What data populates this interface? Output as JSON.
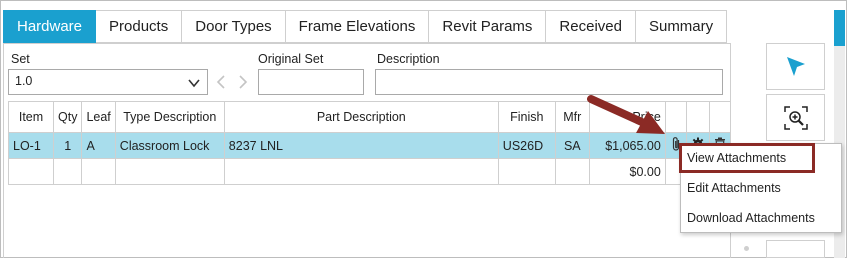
{
  "tabs": [
    {
      "label": "Hardware",
      "active": true
    },
    {
      "label": "Products"
    },
    {
      "label": "Door Types"
    },
    {
      "label": "Frame Elevations"
    },
    {
      "label": "Revit Params"
    },
    {
      "label": "Received"
    },
    {
      "label": "Summary"
    }
  ],
  "form": {
    "set_label": "Set",
    "set_value": "1.0",
    "original_set_label": "Original Set",
    "original_set_value": "",
    "description_label": "Description",
    "description_value": ""
  },
  "table": {
    "columns": [
      "Item",
      "Qty",
      "Leaf",
      "Type Description",
      "Part Description",
      "Finish",
      "Mfr",
      "Price"
    ],
    "rows": [
      {
        "item": "LO-1",
        "qty": "1",
        "leaf": "A",
        "type_description": "Classroom Lock",
        "part_description": "8237 LNL",
        "finish": "US26D",
        "mfr": "SA",
        "price": "$1,065.00"
      },
      {
        "item": "",
        "qty": "",
        "leaf": "",
        "type_description": "",
        "part_description": "",
        "finish": "",
        "mfr": "",
        "price": "$0.00"
      }
    ]
  },
  "context_menu": {
    "items": [
      "View Attachments",
      "Edit Attachments",
      "Download Attachments"
    ]
  },
  "icons": {
    "attachment": "paperclip-icon",
    "settings": "gear-icon",
    "delete": "trash-icon",
    "select_tool": "cursor-arrow-icon",
    "zoom_extents": "zoom-fit-icon"
  },
  "colors": {
    "accent": "#1aa0cf",
    "selected_row": "#a8ddec",
    "annotation": "#8b2a25"
  }
}
